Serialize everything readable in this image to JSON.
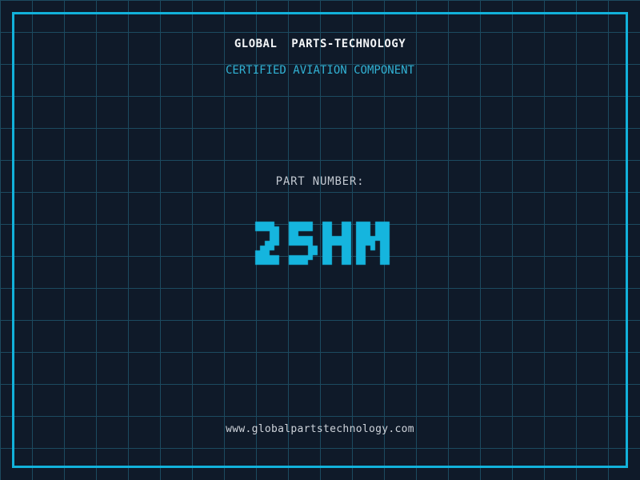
{
  "colors": {
    "background": "#0f1a29",
    "grid_line": "#1c4a5f",
    "frame": "#12b2da",
    "title_text": "#f2f4f6",
    "subtitle_text": "#31b2d4",
    "label_text": "#c3c9d1",
    "url_text": "#ced3da",
    "part_value_accent": "#15b5de"
  },
  "header": {
    "title": "GLOBAL  PARTS-TECHNOLOGY",
    "subtitle": "CERTIFIED AVIATION COMPONENT"
  },
  "part": {
    "label": "PART NUMBER:",
    "value": "25HM",
    "value_color": "#15b5de"
  },
  "footer": {
    "url": "www.globalpartstechnology.com"
  }
}
